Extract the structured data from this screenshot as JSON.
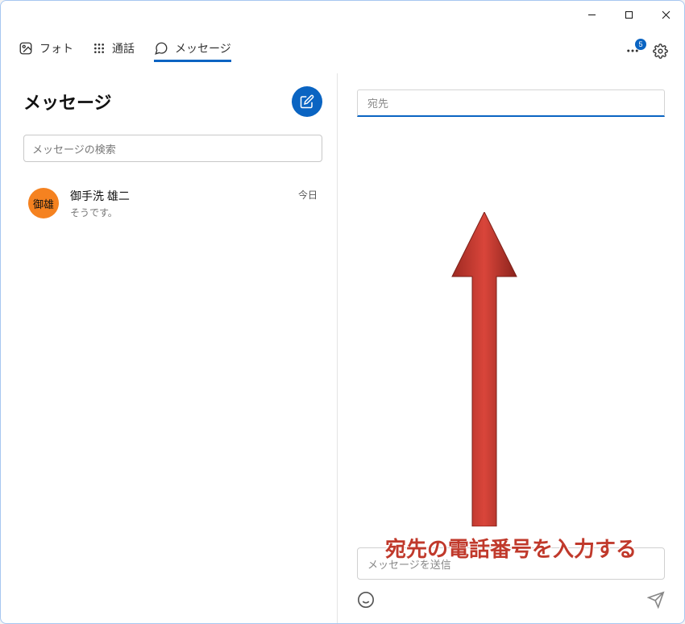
{
  "tabs": {
    "photo": "フォト",
    "calls": "通話",
    "messages": "メッセージ"
  },
  "toolbar": {
    "notification_count": "5"
  },
  "sidebar": {
    "title": "メッセージ",
    "search_placeholder": "メッセージの検索",
    "conversations": [
      {
        "avatar_text": "御雄",
        "name": "御手洗 雄二",
        "preview": "そうです。",
        "time": "今日"
      }
    ]
  },
  "compose": {
    "recipient_placeholder": "宛先",
    "message_placeholder": "メッセージを送信"
  },
  "annotation": "宛先の電話番号を入力する"
}
